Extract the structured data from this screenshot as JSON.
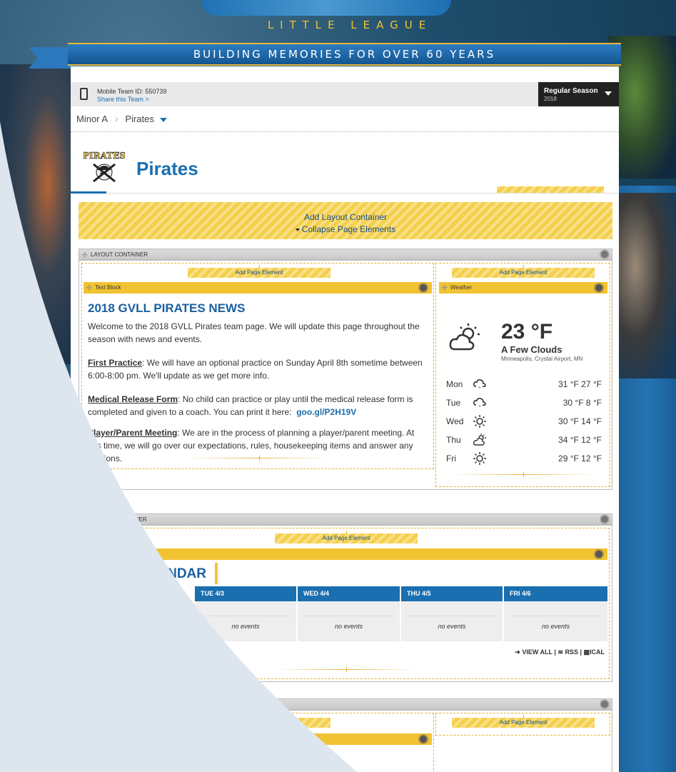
{
  "header": {
    "logo_subtitle": "LITTLE LEAGUE",
    "banner": "BUILDING MEMORIES FOR OVER 60 YEARS"
  },
  "mobile": {
    "team_id": "Mobile Team ID: 550739",
    "share": "Share this Team >"
  },
  "season": {
    "label": "Regular Season",
    "year": "2018"
  },
  "breadcrumb": {
    "division": "Minor A",
    "team": "Pirates"
  },
  "team": {
    "name": "Pirates",
    "logo_text": "PIRATES"
  },
  "layout_tools": {
    "add_container": "Add Layout Container",
    "collapse": "Collapse Page Elements",
    "container_label": "LAYOUT CONTAINER",
    "container_label_partial": "NTAINER",
    "add_element": "Add Page Element",
    "text_block": "Text Block",
    "weather": "Weather"
  },
  "news": {
    "title": "2018 GVLL PIRATES NEWS",
    "intro": "Welcome to the 2018 GVLL Pirates team page. We will update this page throughout the season with news and events.",
    "practice_head": "First Practice",
    "practice_body": ": We will have an optional practice on Sunday April 8th sometime between 6:00-8:00 pm. We'll update as we get more info.",
    "medical_head": "Medical Release Form",
    "medical_body": ": No child can practice or play until the medical release form is completed and given to a coach. You can print it here:",
    "medical_link": "goo.gl/P2H19V",
    "meeting_head": "Player/Parent Meeting",
    "meeting_body_1": ": We are in the process of planning a player/parent meeting.  At",
    "meeting_body_2": "this time, we will go over our expectations, rules, housekeeping items and answer any",
    "meeting_body_3": "uestions."
  },
  "weather": {
    "temp": "23 °F",
    "condition": "A Few Clouds",
    "location": "Minneapolis, Crystal Airport, MN",
    "forecast": [
      {
        "day": "Mon",
        "icon": "cloud-snow-icon",
        "temps": "31 °F  27 °F"
      },
      {
        "day": "Tue",
        "icon": "cloud-snow-icon",
        "temps": "30 °F  8 °F"
      },
      {
        "day": "Wed",
        "icon": "sun-icon",
        "temps": "30 °F  14 °F"
      },
      {
        "day": "Thu",
        "icon": "partly-cloudy-icon",
        "temps": "34 °F  12 °F"
      },
      {
        "day": "Fri",
        "icon": "sun-icon",
        "temps": "29 °F  12 °F"
      }
    ]
  },
  "calendar": {
    "title": "ENDAR",
    "days": [
      {
        "label": "TUE 4/3",
        "events": "no events"
      },
      {
        "label": "WED 4/4",
        "events": "no events"
      },
      {
        "label": "THU 4/5",
        "events": "no events"
      },
      {
        "label": "FRI 4/6",
        "events": "no events"
      }
    ],
    "view_all": "VIEW ALL",
    "rss": "RSS",
    "ical": "ICAL"
  },
  "colors": {
    "brand_blue": "#1a6fb0",
    "gold": "#f3c53c",
    "overlay": "#dde6ef"
  }
}
